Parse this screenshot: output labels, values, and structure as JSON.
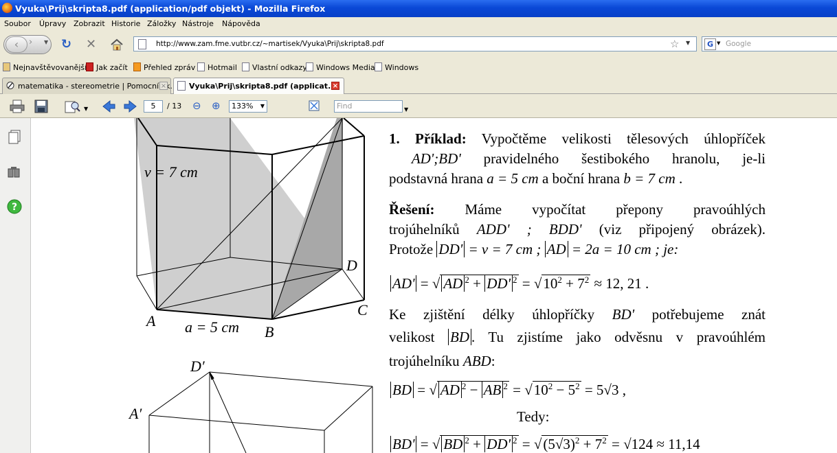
{
  "window": {
    "title": "Vyuka\\Prij\\skripta8.pdf (application/pdf objekt) - Mozilla Firefox"
  },
  "menu": [
    "Soubor",
    "Úpravy",
    "Zobrazit",
    "Historie",
    "Záložky",
    "Nástroje",
    "Nápověda"
  ],
  "address": {
    "url": "http://www.zam.fme.vutbr.cz/~martisek/Vyuka\\Prij\\skripta8.pdf"
  },
  "search": {
    "engine_icon": "google-icon",
    "placeholder": "Google"
  },
  "bookmarks": [
    "Nejnavštěvovanější",
    "Jak začít",
    "Přehled zpráv",
    "Hotmail",
    "Vlastní odkazy",
    "Windows Media",
    "Windows"
  ],
  "tabs": [
    {
      "label": "matematika - stereometrie | Pomocník k...",
      "active": false
    },
    {
      "label": "Vyuka\\Prij\\skripta8.pdf (applicat...",
      "active": true
    }
  ],
  "pdf_toolbar": {
    "page": "5",
    "page_count": "/ 13",
    "zoom": "133%",
    "find_placeholder": "Find"
  },
  "figure1": {
    "labels": {
      "v": "v = 7 cm",
      "a": "a = 5 cm",
      "A": "A",
      "B": "B",
      "C": "C",
      "D": "D"
    }
  },
  "figure2": {
    "labels": {
      "D_prime": "D′",
      "A_prime": "A′"
    }
  },
  "content": {
    "ex_heading": "1. Příklad:",
    "ex_text1": "Vypočtěme velikosti tělesových úhlopříček",
    "ex_text2_math": "AD';BD'",
    "ex_text2_rest": "pravidelného šestibokého hranolu, je-li",
    "ex_text3_a": "podstavná hrana",
    "ex_text3_m1": "a = 5 cm",
    "ex_text3_b": "a boční hrana",
    "ex_text3_m2": "b = 7 cm",
    "ex_text3_end": ".",
    "sol_heading": "Řešení:",
    "sol_text1": "Máme vypočítat přepony pravoúhlých",
    "sol_text2_a": "trojúhelníků",
    "sol_text2_m": "ADD' ; BDD'",
    "sol_text2_b": "(viz připojený obrázek).",
    "sol_text3_a": "Protože",
    "sol_text3_m1": "DD'",
    "sol_text3_m1b": "= v = 7 cm ;",
    "sol_text3_m2": "AD",
    "sol_text3_m2b": "= 2a = 10 cm ; je:",
    "f1_lhs": "AD'",
    "f1_r1": "AD",
    "f1_r2": "DD'",
    "f1_r3": "10",
    "f1_r4": "7",
    "f1_res": "≈ 12, 21 .",
    "p2_a": "Ke zjištění délky úhlopříčky",
    "p2_m": "BD'",
    "p2_b": "potřebujeme znát",
    "p3_a": "velikost",
    "p3_m": "BD",
    "p3_b": ". Tu zjistíme jako odvěsnu v pravoúhlém",
    "p4_a": "trojúhelníku",
    "p4_m": "ABD",
    "p4_b": ":",
    "f2_lhs": "BD",
    "f2_r1": "AD",
    "f2_r2": "AB",
    "f2_r3": "10",
    "f2_r4": "5",
    "f2_res": "= 5√3 ,",
    "tedy": "Tedy:",
    "f3_lhs": "BD'",
    "f3_r1": "BD",
    "f3_r2": "DD'",
    "f3_r3": "(5√3)",
    "f3_r4": "7",
    "f3_r5": "= √124",
    "f3_res": "≈ 11,14"
  }
}
